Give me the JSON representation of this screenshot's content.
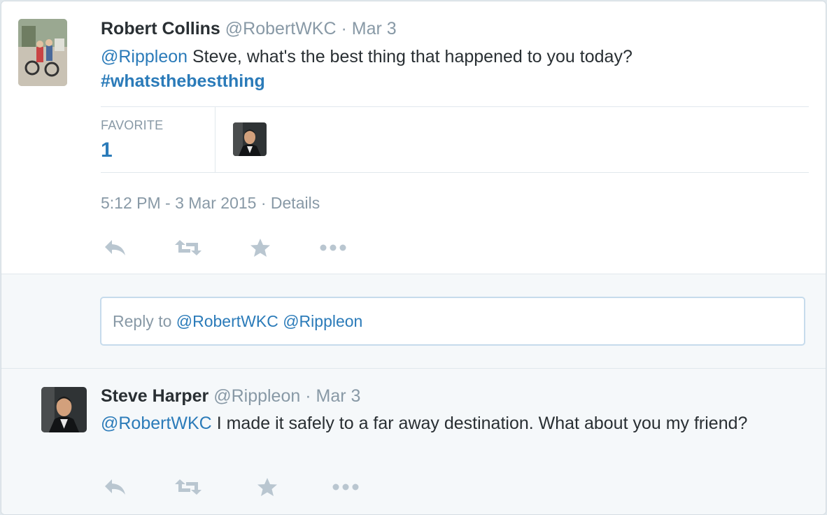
{
  "main_tweet": {
    "fullname": "Robert Collins",
    "username": "@RobertWKC",
    "separator": "·",
    "date": "Mar 3",
    "mention": "@Rippleon",
    "text": " Steve, what's the best thing that happened to you today?",
    "hashtag": "#whatsthebestthing",
    "stats": {
      "label": "FAVORITE",
      "count": "1"
    },
    "timestamp": "5:12 PM - 3 Mar 2015",
    "dot": "·",
    "details_link": "Details",
    "actions": [
      "reply-icon",
      "retweet-icon",
      "favorite-icon",
      "more-icon"
    ]
  },
  "reply_box": {
    "prefix": "Reply to ",
    "mention1": "@RobertWKC",
    "space": " ",
    "mention2": "@Rippleon"
  },
  "reply_tweet": {
    "fullname": "Steve Harper",
    "username": "@Rippleon",
    "separator": "·",
    "date": "Mar 3",
    "mention": "@RobertWKC",
    "text": " I made it safely to a far away destination. What about you my friend?",
    "actions": [
      "reply-icon",
      "retweet-icon",
      "favorite-icon",
      "more-icon"
    ]
  },
  "colors": {
    "link": "#2b7bb9",
    "muted": "#8899a6",
    "icon": "#b9c6d0",
    "text": "#292f33"
  }
}
